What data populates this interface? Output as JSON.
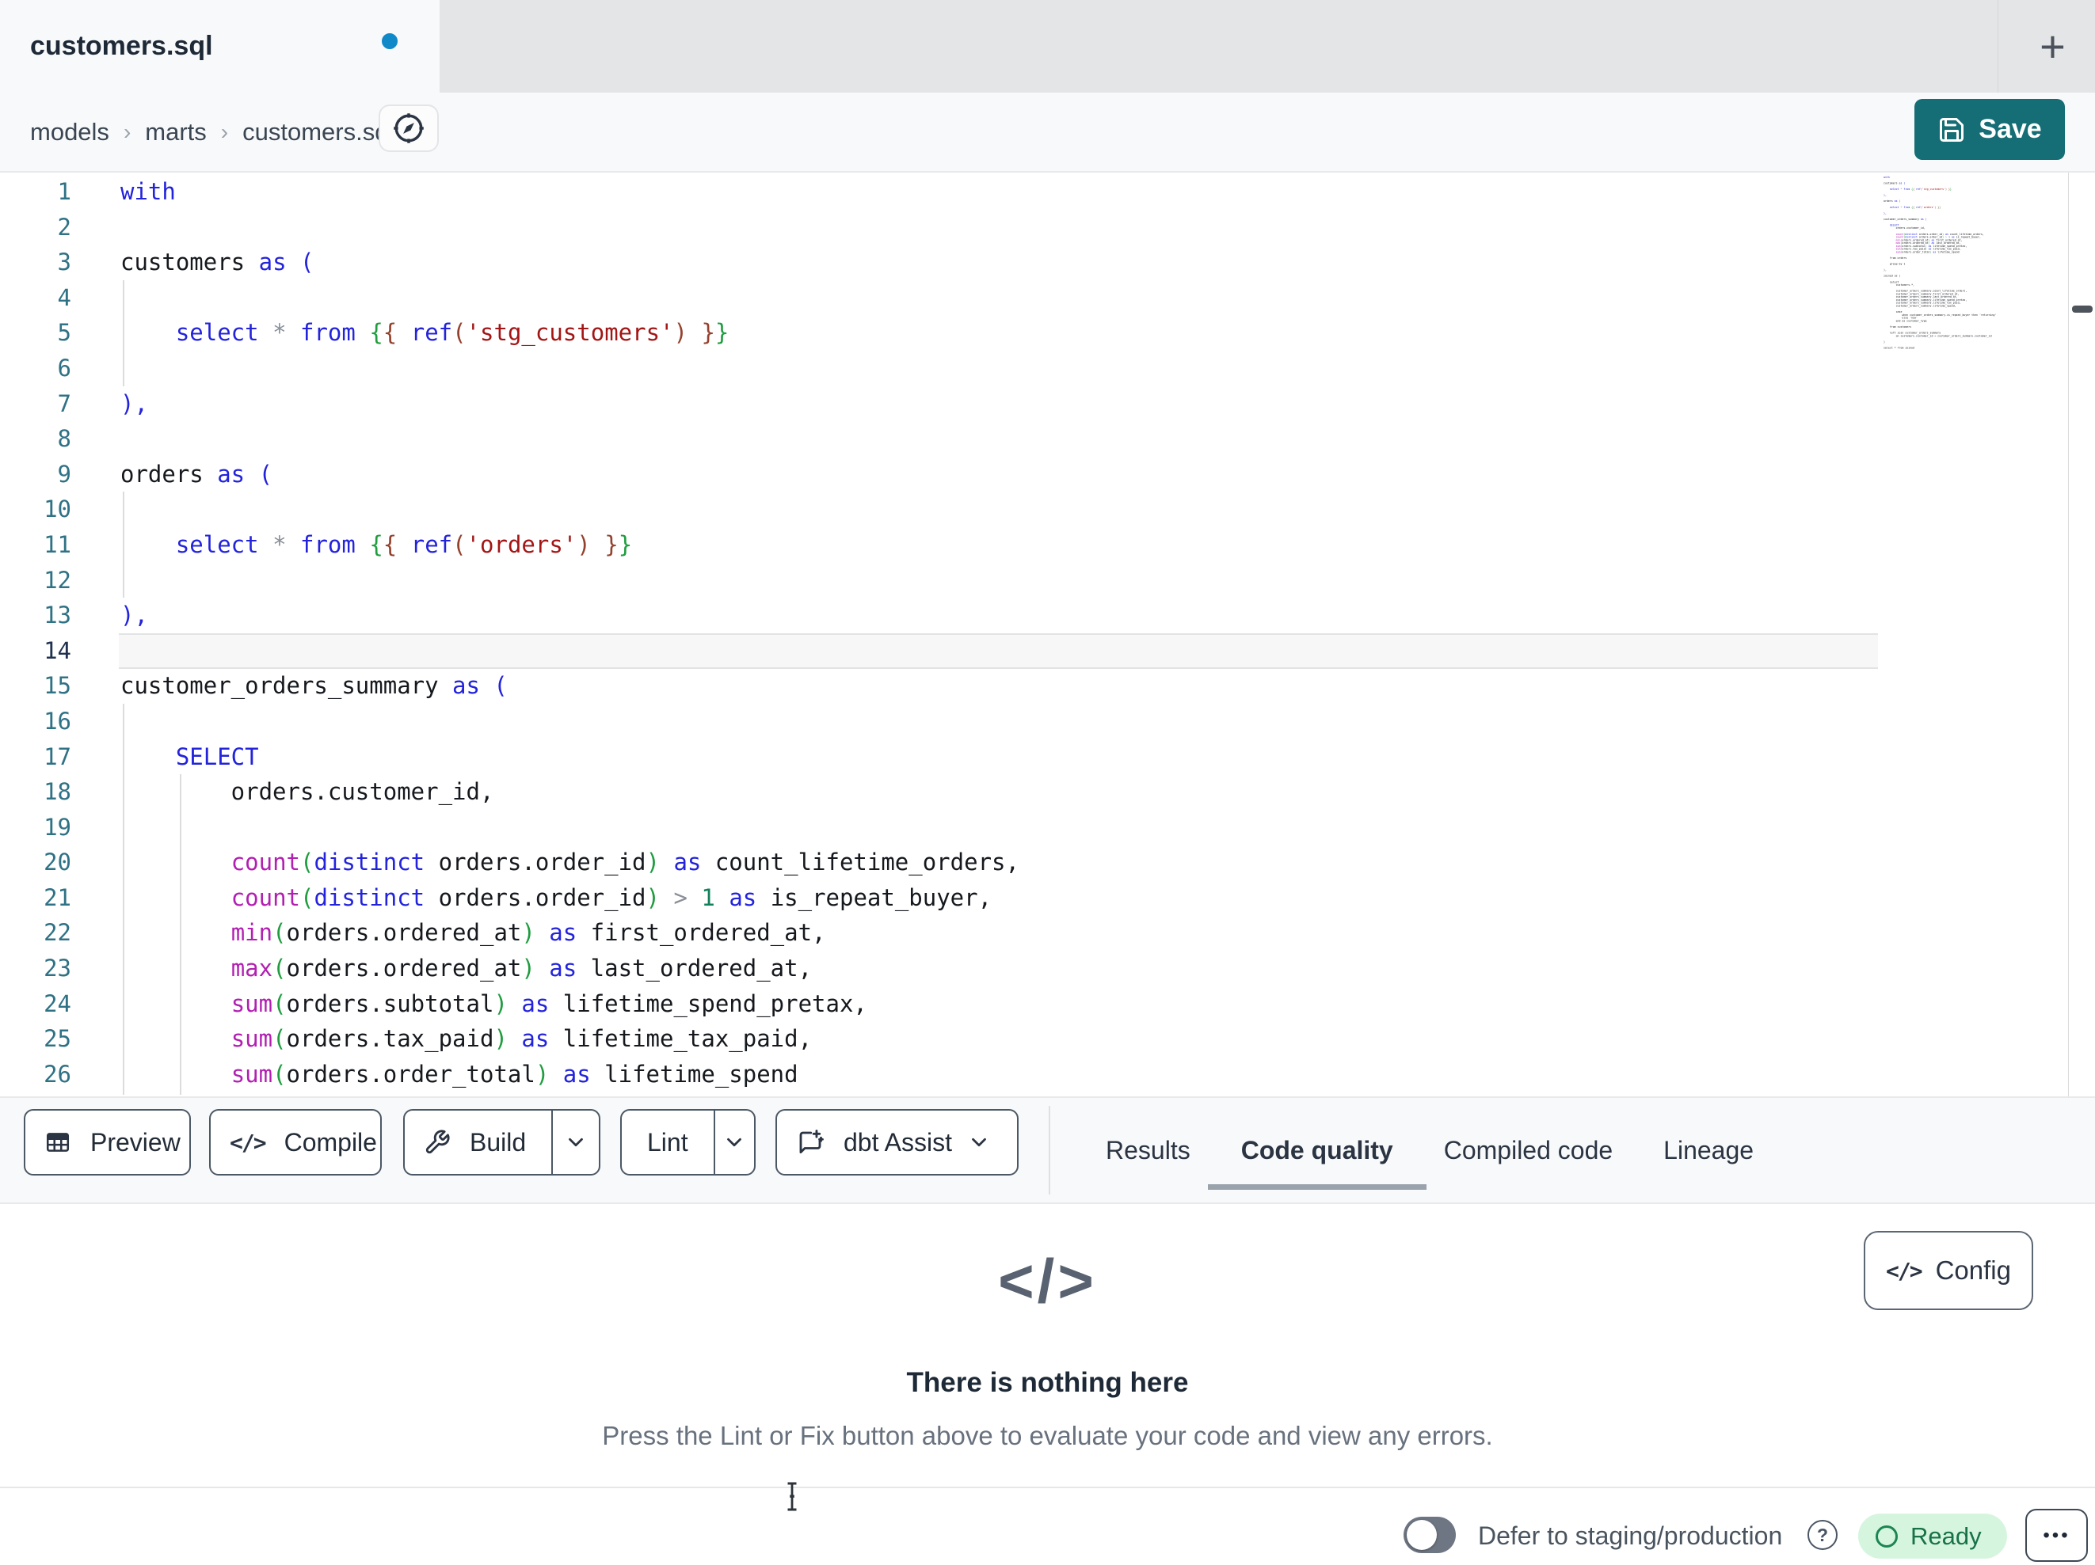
{
  "tab_bar": {
    "active_tab_title": "customers.sql",
    "has_unsaved_changes": true,
    "new_tab_glyph": "+"
  },
  "breadcrumb": {
    "items": [
      "models",
      "marts",
      "customers.sql"
    ],
    "separator": "›"
  },
  "header": {
    "save_label": "Save"
  },
  "editor": {
    "language": "sql",
    "active_line": 14,
    "lines": [
      {
        "n": 1,
        "t": [
          [
            "k",
            "with"
          ]
        ]
      },
      {
        "n": 2,
        "t": []
      },
      {
        "n": 3,
        "t": [
          [
            "d",
            "customers "
          ],
          [
            "k",
            "as"
          ],
          [
            "d",
            " "
          ],
          [
            "k",
            "("
          ]
        ]
      },
      {
        "n": 4,
        "t": []
      },
      {
        "n": 5,
        "t": [
          [
            "d",
            "    "
          ],
          [
            "k",
            "select"
          ],
          [
            "d",
            " "
          ],
          [
            "g",
            "*"
          ],
          [
            "d",
            " "
          ],
          [
            "k",
            "from"
          ],
          [
            "d",
            " "
          ],
          [
            "p",
            "{"
          ],
          [
            "b",
            "{"
          ],
          [
            "d",
            " "
          ],
          [
            "k",
            "ref"
          ],
          [
            "b",
            "("
          ],
          [
            "s",
            "'stg_customers'"
          ],
          [
            "b",
            ")"
          ],
          [
            "d",
            " "
          ],
          [
            "b",
            "}"
          ],
          [
            "p",
            "}"
          ]
        ]
      },
      {
        "n": 6,
        "t": []
      },
      {
        "n": 7,
        "t": [
          [
            "k",
            "),"
          ]
        ]
      },
      {
        "n": 8,
        "t": []
      },
      {
        "n": 9,
        "t": [
          [
            "d",
            "orders "
          ],
          [
            "k",
            "as"
          ],
          [
            "d",
            " "
          ],
          [
            "k",
            "("
          ]
        ]
      },
      {
        "n": 10,
        "t": []
      },
      {
        "n": 11,
        "t": [
          [
            "d",
            "    "
          ],
          [
            "k",
            "select"
          ],
          [
            "d",
            " "
          ],
          [
            "g",
            "*"
          ],
          [
            "d",
            " "
          ],
          [
            "k",
            "from"
          ],
          [
            "d",
            " "
          ],
          [
            "p",
            "{"
          ],
          [
            "b",
            "{"
          ],
          [
            "d",
            " "
          ],
          [
            "k",
            "ref"
          ],
          [
            "b",
            "("
          ],
          [
            "s",
            "'orders'"
          ],
          [
            "b",
            ")"
          ],
          [
            "d",
            " "
          ],
          [
            "b",
            "}"
          ],
          [
            "p",
            "}"
          ]
        ]
      },
      {
        "n": 12,
        "t": []
      },
      {
        "n": 13,
        "t": [
          [
            "k",
            "),"
          ]
        ]
      },
      {
        "n": 14,
        "t": []
      },
      {
        "n": 15,
        "t": [
          [
            "d",
            "customer_orders_summary "
          ],
          [
            "k",
            "as"
          ],
          [
            "d",
            " "
          ],
          [
            "k",
            "("
          ]
        ]
      },
      {
        "n": 16,
        "t": []
      },
      {
        "n": 17,
        "t": [
          [
            "d",
            "    "
          ],
          [
            "k",
            "SELECT"
          ]
        ]
      },
      {
        "n": 18,
        "t": [
          [
            "d",
            "        orders.customer_id,"
          ]
        ]
      },
      {
        "n": 19,
        "t": []
      },
      {
        "n": 20,
        "t": [
          [
            "d",
            "        "
          ],
          [
            "f",
            "count"
          ],
          [
            "p",
            "("
          ],
          [
            "k",
            "distinct"
          ],
          [
            "d",
            " orders.order_id"
          ],
          [
            "p",
            ")"
          ],
          [
            "d",
            " "
          ],
          [
            "k",
            "as"
          ],
          [
            "d",
            " count_lifetime_orders,"
          ]
        ]
      },
      {
        "n": 21,
        "t": [
          [
            "d",
            "        "
          ],
          [
            "f",
            "count"
          ],
          [
            "p",
            "("
          ],
          [
            "k",
            "distinct"
          ],
          [
            "d",
            " orders.order_id"
          ],
          [
            "p",
            ")"
          ],
          [
            "d",
            " "
          ],
          [
            "o",
            ">"
          ],
          [
            "d",
            " "
          ],
          [
            "n",
            "1"
          ],
          [
            "d",
            " "
          ],
          [
            "k",
            "as"
          ],
          [
            "d",
            " is_repeat_buyer,"
          ]
        ]
      },
      {
        "n": 22,
        "t": [
          [
            "d",
            "        "
          ],
          [
            "f",
            "min"
          ],
          [
            "p",
            "("
          ],
          [
            "d",
            "orders.ordered_at"
          ],
          [
            "p",
            ")"
          ],
          [
            "d",
            " "
          ],
          [
            "k",
            "as"
          ],
          [
            "d",
            " first_ordered_at,"
          ]
        ]
      },
      {
        "n": 23,
        "t": [
          [
            "d",
            "        "
          ],
          [
            "f",
            "max"
          ],
          [
            "p",
            "("
          ],
          [
            "d",
            "orders.ordered_at"
          ],
          [
            "p",
            ")"
          ],
          [
            "d",
            " "
          ],
          [
            "k",
            "as"
          ],
          [
            "d",
            " last_ordered_at,"
          ]
        ]
      },
      {
        "n": 24,
        "t": [
          [
            "d",
            "        "
          ],
          [
            "f",
            "sum"
          ],
          [
            "p",
            "("
          ],
          [
            "d",
            "orders.subtotal"
          ],
          [
            "p",
            ")"
          ],
          [
            "d",
            " "
          ],
          [
            "k",
            "as"
          ],
          [
            "d",
            " lifetime_spend_pretax,"
          ]
        ]
      },
      {
        "n": 25,
        "t": [
          [
            "d",
            "        "
          ],
          [
            "f",
            "sum"
          ],
          [
            "p",
            "("
          ],
          [
            "d",
            "orders.tax_paid"
          ],
          [
            "p",
            ")"
          ],
          [
            "d",
            " "
          ],
          [
            "k",
            "as"
          ],
          [
            "d",
            " lifetime_tax_paid,"
          ]
        ]
      },
      {
        "n": 26,
        "t": [
          [
            "d",
            "        "
          ],
          [
            "f",
            "sum"
          ],
          [
            "p",
            "("
          ],
          [
            "d",
            "orders.order_total"
          ],
          [
            "p",
            ")"
          ],
          [
            "d",
            " "
          ],
          [
            "k",
            "as"
          ],
          [
            "d",
            " lifetime_spend"
          ]
        ]
      }
    ],
    "minimap_extra_lines": [
      "",
      "    from orders",
      "",
      "    group by 1",
      "",
      "),",
      "",
      "joined as (",
      "",
      "    select",
      "        customers.*,",
      "",
      "        customer_orders_summary.count_lifetime_orders,",
      "        customer_orders_summary.first_ordered_at,",
      "        customer_orders_summary.last_ordered_at,",
      "        customer_orders_summary.lifetime_spend_pretax,",
      "        customer_orders_summary.lifetime_tax_paid,",
      "        customer_orders_summary.lifetime_spend,",
      "",
      "        case",
      "            when customer_orders_summary.is_repeat_buyer then 'returning'",
      "            else 'new'",
      "        end as customer_type",
      "",
      "    from customers",
      "",
      "    left join customer_orders_summary",
      "        on customers.customer_id = customer_orders_summary.customer_id",
      "",
      ")",
      "",
      "select * from joined"
    ]
  },
  "toolbar": {
    "preview_label": "Preview",
    "compile_label": "Compile",
    "build_label": "Build",
    "lint_label": "Lint",
    "assist_label": "dbt Assist",
    "compile_icon_glyph": "</>"
  },
  "panel_tabs": [
    {
      "label": "Results",
      "active": false
    },
    {
      "label": "Code quality",
      "active": true
    },
    {
      "label": "Compiled code",
      "active": false
    },
    {
      "label": "Lineage",
      "active": false
    }
  ],
  "panel": {
    "empty_icon_glyph": "</>",
    "empty_title": "There is nothing here",
    "empty_subtitle": "Press the Lint or Fix button above to evaluate your code and view any errors.",
    "config_label": "Config",
    "config_icon_glyph": "</>"
  },
  "status_bar": {
    "defer_label": "Defer to staging/production",
    "help_glyph": "?",
    "ready_label": "Ready",
    "more_glyph": "•••"
  },
  "colors": {
    "save_button_teal": "#156d75",
    "unsaved_dot_blue": "#1089c9",
    "ready_badge_bg": "#d6f5de",
    "ready_badge_text": "#17724a",
    "ready_badge_ring": "#1b8653",
    "line_number_teal": "#2f7285",
    "active_line_number": "#1f3050",
    "keyword_blue": "#2323dc",
    "function_magenta": "#b21fb2",
    "paren_green": "#1f9d3f",
    "string_red": "#a31515",
    "ref_paren_brown": "#94422e",
    "number_green": "#12805c",
    "tab_underline_gray": "#9aa2ac"
  }
}
